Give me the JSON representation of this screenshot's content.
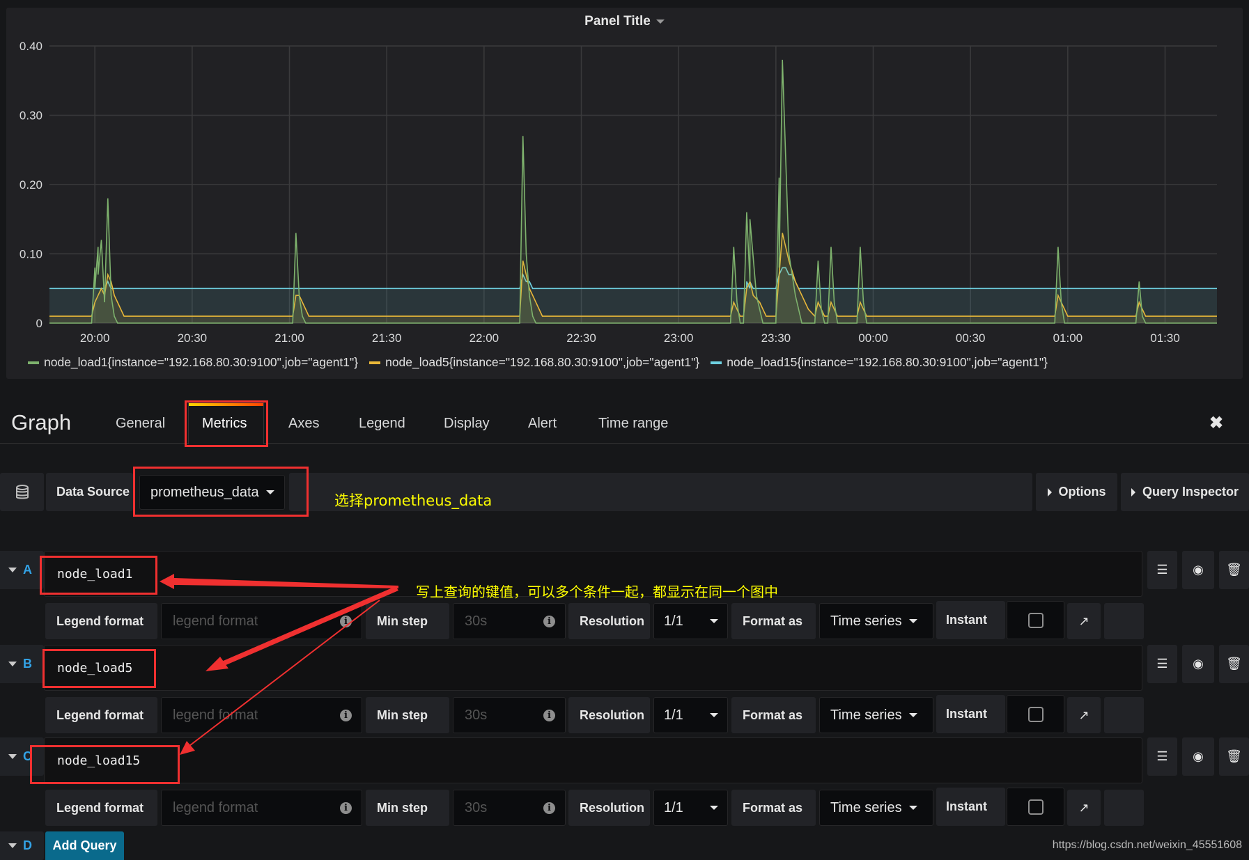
{
  "panel": {
    "title": "Panel Title"
  },
  "chart_data": {
    "type": "line",
    "title": "Panel Title",
    "xlim": [
      "19:46",
      "01:46"
    ],
    "ylim": [
      0,
      0.4
    ],
    "x_ticks": [
      "20:00",
      "20:30",
      "21:00",
      "21:30",
      "22:00",
      "22:30",
      "23:00",
      "23:30",
      "00:00",
      "00:30",
      "01:00",
      "01:30"
    ],
    "y_ticks": [
      {
        "value": 0,
        "label": "0"
      },
      {
        "value": 0.1,
        "label": "0.10"
      },
      {
        "value": 0.2,
        "label": "0.20"
      },
      {
        "value": 0.3,
        "label": "0.30"
      },
      {
        "value": 0.4,
        "label": "0.40"
      }
    ],
    "grid": true,
    "legend_position": "bottom",
    "series": [
      {
        "name": "node_load15{instance=\"192.168.80.30:9100\",job=\"agent1\"}",
        "color": "#6ed0e0",
        "points": [
          [
            "19:46",
            0.05
          ],
          [
            "20:03",
            0.05
          ],
          [
            "20:04",
            0.06
          ],
          [
            "20:05",
            0.05
          ],
          [
            "22:11",
            0.05
          ],
          [
            "22:12",
            0.07
          ],
          [
            "22:13",
            0.06
          ],
          [
            "22:14",
            0.06
          ],
          [
            "22:15",
            0.05
          ],
          [
            "23:21",
            0.05
          ],
          [
            "23:21",
            0.06
          ],
          [
            "23:22",
            0.05
          ],
          [
            "23:22",
            0.06
          ],
          [
            "23:23",
            0.05
          ],
          [
            "23:30",
            0.05
          ],
          [
            "23:31",
            0.07
          ],
          [
            "23:32",
            0.08
          ],
          [
            "23:33",
            0.08
          ],
          [
            "23:34",
            0.07
          ],
          [
            "23:35",
            0.07
          ],
          [
            "23:36",
            0.06
          ],
          [
            "23:37",
            0.05
          ],
          [
            "01:46",
            0.05
          ]
        ]
      },
      {
        "name": "node_load5{instance=\"192.168.80.30:9100\",job=\"agent1\"}",
        "color": "#eab839",
        "points": [
          [
            "19:46",
            0.01
          ],
          [
            "19:59",
            0.01
          ],
          [
            "20:00",
            0.03
          ],
          [
            "20:01",
            0.04
          ],
          [
            "20:02",
            0.05
          ],
          [
            "20:03",
            0.04
          ],
          [
            "20:04",
            0.07
          ],
          [
            "20:05",
            0.06
          ],
          [
            "20:06",
            0.04
          ],
          [
            "20:07",
            0.03
          ],
          [
            "20:08",
            0.02
          ],
          [
            "20:09",
            0.01
          ],
          [
            "21:01",
            0.01
          ],
          [
            "21:02",
            0.04
          ],
          [
            "21:03",
            0.04
          ],
          [
            "21:04",
            0.03
          ],
          [
            "21:05",
            0.02
          ],
          [
            "21:06",
            0.01
          ],
          [
            "22:11",
            0.01
          ],
          [
            "22:12",
            0.09
          ],
          [
            "22:13",
            0.07
          ],
          [
            "22:14",
            0.05
          ],
          [
            "22:15",
            0.04
          ],
          [
            "22:16",
            0.03
          ],
          [
            "22:17",
            0.02
          ],
          [
            "22:18",
            0.01
          ],
          [
            "23:16",
            0.01
          ],
          [
            "23:17",
            0.03
          ],
          [
            "23:18",
            0.02
          ],
          [
            "23:19",
            0.01
          ],
          [
            "23:20",
            0.01
          ],
          [
            "23:21",
            0.05
          ],
          [
            "23:22",
            0.06
          ],
          [
            "23:23",
            0.04
          ],
          [
            "23:25",
            0.03
          ],
          [
            "23:26",
            0.02
          ],
          [
            "23:27",
            0.01
          ],
          [
            "23:30",
            0.01
          ],
          [
            "23:31",
            0.07
          ],
          [
            "23:32",
            0.13
          ],
          [
            "23:34",
            0.09
          ],
          [
            "23:36",
            0.06
          ],
          [
            "23:38",
            0.04
          ],
          [
            "23:40",
            0.02
          ],
          [
            "23:42",
            0.01
          ],
          [
            "23:43",
            0.03
          ],
          [
            "23:44",
            0.02
          ],
          [
            "23:45",
            0.01
          ],
          [
            "23:46",
            0.01
          ],
          [
            "23:47",
            0.03
          ],
          [
            "23:48",
            0.02
          ],
          [
            "23:49",
            0.01
          ],
          [
            "23:55",
            0.01
          ],
          [
            "23:56",
            0.03
          ],
          [
            "23:57",
            0.02
          ],
          [
            "23:58",
            0.01
          ],
          [
            "00:56",
            0.01
          ],
          [
            "00:57",
            0.04
          ],
          [
            "00:58",
            0.03
          ],
          [
            "00:59",
            0.02
          ],
          [
            "01:00",
            0.01
          ],
          [
            "01:21",
            0.01
          ],
          [
            "01:22",
            0.03
          ],
          [
            "01:23",
            0.02
          ],
          [
            "01:24",
            0.01
          ],
          [
            "01:46",
            0.01
          ]
        ]
      },
      {
        "name": "node_load1{instance=\"192.168.80.30:9100\",job=\"agent1\"}",
        "color": "#7eb26d",
        "points": [
          [
            "19:46",
            0
          ],
          [
            "19:59",
            0
          ],
          [
            "20:00",
            0.08
          ],
          [
            "20:00",
            0.05
          ],
          [
            "20:01",
            0.11
          ],
          [
            "20:01",
            0.07
          ],
          [
            "20:02",
            0.12
          ],
          [
            "20:03",
            0.03
          ],
          [
            "20:04",
            0.18
          ],
          [
            "20:05",
            0.04
          ],
          [
            "20:06",
            0.01
          ],
          [
            "20:07",
            0
          ],
          [
            "21:01",
            0
          ],
          [
            "21:02",
            0.13
          ],
          [
            "21:03",
            0.04
          ],
          [
            "21:04",
            0.01
          ],
          [
            "21:05",
            0
          ],
          [
            "22:11",
            0
          ],
          [
            "22:12",
            0.27
          ],
          [
            "22:13",
            0.1
          ],
          [
            "22:14",
            0.04
          ],
          [
            "22:15",
            0.01
          ],
          [
            "22:16",
            0
          ],
          [
            "23:16",
            0
          ],
          [
            "23:17",
            0.11
          ],
          [
            "23:18",
            0.03
          ],
          [
            "23:19",
            0
          ],
          [
            "23:20",
            0
          ],
          [
            "23:21",
            0.16
          ],
          [
            "23:22",
            0.06
          ],
          [
            "23:22",
            0.15
          ],
          [
            "23:24",
            0.04
          ],
          [
            "23:26",
            0
          ],
          [
            "23:30",
            0
          ],
          [
            "23:31",
            0.21
          ],
          [
            "23:31",
            0.08
          ],
          [
            "23:32",
            0.38
          ],
          [
            "23:34",
            0.1
          ],
          [
            "23:36",
            0.04
          ],
          [
            "23:38",
            0
          ],
          [
            "23:42",
            0
          ],
          [
            "23:43",
            0.09
          ],
          [
            "23:44",
            0.02
          ],
          [
            "23:45",
            0
          ],
          [
            "23:46",
            0
          ],
          [
            "23:47",
            0.11
          ],
          [
            "23:48",
            0.03
          ],
          [
            "23:49",
            0
          ],
          [
            "23:55",
            0
          ],
          [
            "23:56",
            0.11
          ],
          [
            "23:57",
            0.03
          ],
          [
            "23:58",
            0
          ],
          [
            "00:56",
            0
          ],
          [
            "00:57",
            0.11
          ],
          [
            "00:58",
            0.03
          ],
          [
            "00:59",
            0
          ],
          [
            "01:21",
            0
          ],
          [
            "01:22",
            0.06
          ],
          [
            "01:23",
            0.01
          ],
          [
            "01:24",
            0
          ],
          [
            "01:46",
            0
          ]
        ]
      }
    ]
  },
  "legend": [
    {
      "label": "node_load1{instance=\"192.168.80.30:9100\",job=\"agent1\"}",
      "color": "#7eb26d"
    },
    {
      "label": "node_load5{instance=\"192.168.80.30:9100\",job=\"agent1\"}",
      "color": "#eab839"
    },
    {
      "label": "node_load15{instance=\"192.168.80.30:9100\",job=\"agent1\"}",
      "color": "#6ed0e0"
    }
  ],
  "editor": {
    "title": "Graph",
    "tabs": [
      "General",
      "Metrics",
      "Axes",
      "Legend",
      "Display",
      "Alert",
      "Time range"
    ],
    "active_tab": "Metrics",
    "close_icon": "close-icon"
  },
  "datasource": {
    "label": "Data Source",
    "value": "prometheus_data",
    "options_label": "Options",
    "inspector_label": "Query Inspector"
  },
  "queries": [
    {
      "letter": "A",
      "expr": "node_load1",
      "legend_label": "Legend format",
      "legend_placeholder": "legend format",
      "minstep_label": "Min step",
      "minstep_placeholder": "30s",
      "resolution_label": "Resolution",
      "resolution": "1/1",
      "format_label": "Format as",
      "format": "Time series",
      "instant_label": "Instant",
      "instant": false
    },
    {
      "letter": "B",
      "expr": "node_load5",
      "legend_label": "Legend format",
      "legend_placeholder": "legend format",
      "minstep_label": "Min step",
      "minstep_placeholder": "30s",
      "resolution_label": "Resolution",
      "resolution": "1/1",
      "format_label": "Format as",
      "format": "Time series",
      "instant_label": "Instant",
      "instant": false
    },
    {
      "letter": "C",
      "expr": "node_load15",
      "legend_label": "Legend format",
      "legend_placeholder": "legend format",
      "minstep_label": "Min step",
      "minstep_placeholder": "30s",
      "resolution_label": "Resolution",
      "resolution": "1/1",
      "format_label": "Format as",
      "format": "Time series",
      "instant_label": "Instant",
      "instant": false
    }
  ],
  "add_query": {
    "letter": "D",
    "label": "Add Query"
  },
  "annotations": {
    "datasource_note": "选择prometheus_data",
    "query_note": "写上查询的键值，可以多个条件一起，都显示在同一个图中",
    "color": "#ffff00",
    "box_color": "#f03030"
  },
  "watermark": "https://blog.csdn.net/weixin_45551608"
}
